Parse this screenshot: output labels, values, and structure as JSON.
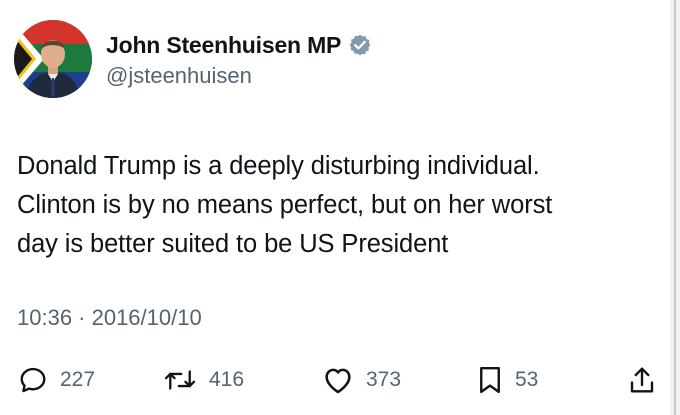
{
  "author": {
    "display_name": "John Steenhuisen MP",
    "handle": "@jsteenhuisen",
    "verified_color": "#829aab"
  },
  "tweet": {
    "lines": [
      "Donald Trump is a deeply disturbing individual.",
      "Clinton is by no means perfect, but on her worst",
      "day is better suited to be US President"
    ],
    "timestamp": "10:36 · 2016/10/10"
  },
  "actions": {
    "replies": "227",
    "reposts": "416",
    "likes": "373",
    "bookmarks": "53"
  },
  "icons": {
    "reply": "speech-bubble",
    "repost": "retweet-arrows",
    "like": "heart",
    "bookmark": "bookmark",
    "share": "share-up-arrow"
  }
}
